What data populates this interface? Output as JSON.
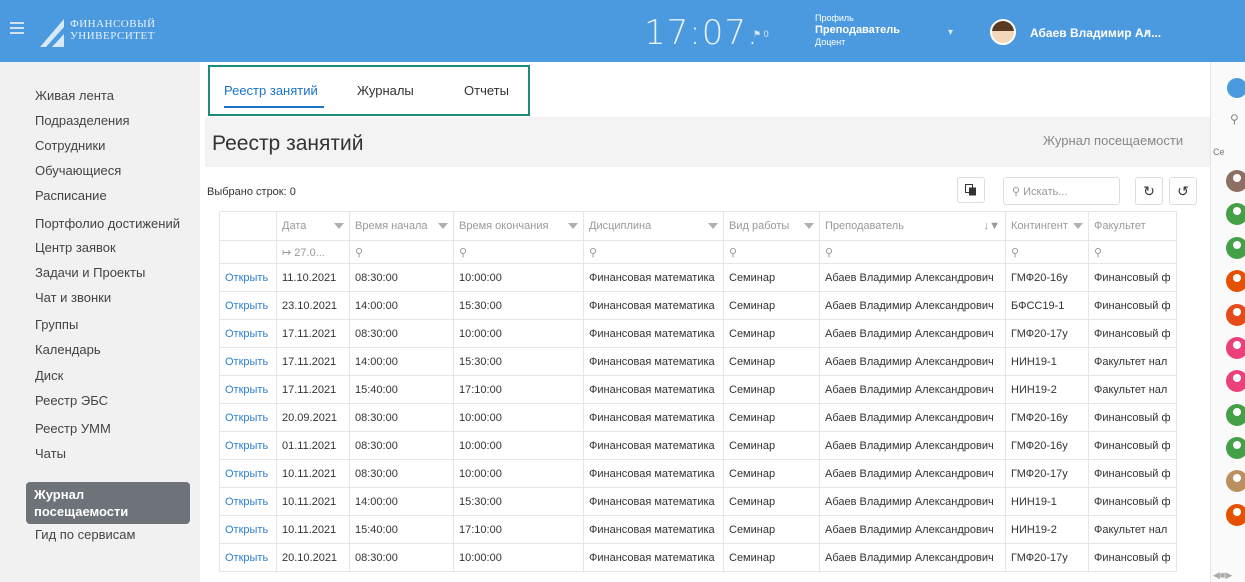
{
  "header": {
    "logo_line1": "ФИНАНСОВЫЙ",
    "logo_line2": "УНИВЕРСИТЕТ",
    "clock": "17:07.",
    "notifications": "0",
    "profile_label": "Профиль",
    "profile_role": "Преподаватель",
    "profile_title": "Доцент",
    "user_name": "Абаев Владимир Ал..."
  },
  "sidebar": {
    "items": [
      "Живая лента",
      "Подразделения",
      "Сотрудники",
      "Обучающиеся",
      "Расписание",
      "Портфолио достижений",
      "Центр заявок",
      "Задачи и Проекты",
      "Чат и звонки",
      "Группы",
      "Календарь",
      "Диск",
      "Реестр ЭБС",
      "Реестр УММ",
      "Чаты"
    ],
    "active_line1": "Журнал",
    "active_line2": "посещаемости",
    "last_item": "Гид по сервисам"
  },
  "tabs": [
    "Реестр занятий",
    "Журналы",
    "Отчеты"
  ],
  "page": {
    "title": "Реестр занятий",
    "attendance_link": "Журнал посещаемости",
    "selected_rows": "Выбрано строк: 0",
    "search_placeholder": "Искать..."
  },
  "table": {
    "columns": [
      "",
      "Дата",
      "Время начала",
      "Время окончания",
      "Дисциплина",
      "Вид работы",
      "Преподаватель",
      "Контингент",
      "Факультет"
    ],
    "date_filter": "27.0...",
    "open_label": "Открыть",
    "rows": [
      [
        "11.10.2021",
        "08:30:00",
        "10:00:00",
        "Финансовая математика",
        "Семинар",
        "Абаев Владимир Александрович",
        "ГМФ20-16у",
        "Финансовый ф"
      ],
      [
        "23.10.2021",
        "14:00:00",
        "15:30:00",
        "Финансовая математика",
        "Семинар",
        "Абаев Владимир Александрович",
        "БФСС19-1",
        "Финансовый ф"
      ],
      [
        "17.11.2021",
        "08:30:00",
        "10:00:00",
        "Финансовая математика",
        "Семинар",
        "Абаев Владимир Александрович",
        "ГМФ20-17у",
        "Финансовый ф"
      ],
      [
        "17.11.2021",
        "14:00:00",
        "15:30:00",
        "Финансовая математика",
        "Семинар",
        "Абаев Владимир Александрович",
        "НИН19-1",
        "Факультет нал"
      ],
      [
        "17.11.2021",
        "15:40:00",
        "17:10:00",
        "Финансовая математика",
        "Семинар",
        "Абаев Владимир Александрович",
        "НИН19-2",
        "Факультет нал"
      ],
      [
        "20.09.2021",
        "08:30:00",
        "10:00:00",
        "Финансовая математика",
        "Семинар",
        "Абаев Владимир Александрович",
        "ГМФ20-16у",
        "Финансовый ф"
      ],
      [
        "01.11.2021",
        "08:30:00",
        "10:00:00",
        "Финансовая математика",
        "Семинар",
        "Абаев Владимир Александрович",
        "ГМФ20-16у",
        "Финансовый ф"
      ],
      [
        "10.11.2021",
        "08:30:00",
        "10:00:00",
        "Финансовая математика",
        "Семинар",
        "Абаев Владимир Александрович",
        "ГМФ20-17у",
        "Финансовый ф"
      ],
      [
        "10.11.2021",
        "14:00:00",
        "15:30:00",
        "Финансовая математика",
        "Семинар",
        "Абаев Владимир Александрович",
        "НИН19-1",
        "Финансовый ф"
      ],
      [
        "10.11.2021",
        "15:40:00",
        "17:10:00",
        "Финансовая математика",
        "Семинар",
        "Абаев Владимир Александрович",
        "НИН19-2",
        "Факультет нал"
      ],
      [
        "20.10.2021",
        "08:30:00",
        "10:00:00",
        "Финансовая математика",
        "Семинар",
        "Абаев Владимир Александрович",
        "ГМФ20-17у",
        "Финансовый ф"
      ]
    ]
  },
  "right_strip": {
    "label": "Се",
    "avatar_colors": [
      "#8d6e63",
      "#43a047",
      "#43a047",
      "#e65100",
      "#e64a19",
      "#ec407a",
      "#ec407a",
      "#43a047",
      "#43a047",
      "#bc8f5f",
      "#e65100"
    ]
  },
  "colors": {
    "header_bg": "#4b9ae0",
    "accent": "#1a73c8",
    "highlight_box": "#1e8a7c",
    "active_sidebar": "#6e7379"
  }
}
